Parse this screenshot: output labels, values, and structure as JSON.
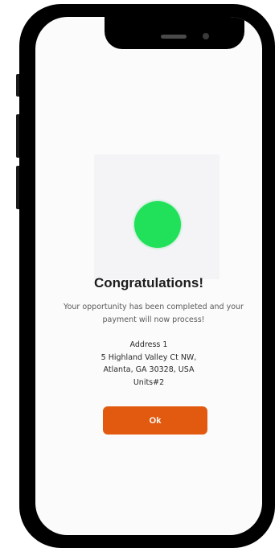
{
  "device": {
    "frame_color": "#000000",
    "screen_color": "#fbfbfc"
  },
  "dialog": {
    "icon": "success-circle-icon",
    "icon_color": "#21e05a",
    "title": "Congratulations!",
    "message": "Your opportunity has been completed and your payment will now process!",
    "address": {
      "label": "Address 1",
      "street": "5 Highland Valley Ct NW,",
      "city_line": "Atlanta, GA 30328, USA",
      "units": "Units#2"
    },
    "ok_button": {
      "label": "Ok",
      "color": "#e25a10"
    }
  }
}
